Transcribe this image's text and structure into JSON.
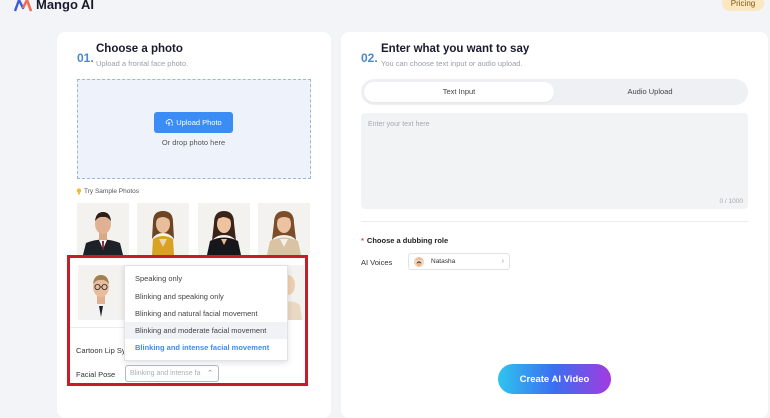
{
  "brand": {
    "name": "Mango AI",
    "pricing": "Pricing"
  },
  "step1": {
    "number": "01.",
    "title": "Choose a photo",
    "subtitle": "Upload a frontal face photo.",
    "upload_button": "Upload Photo",
    "drop_text": "Or drop photo here",
    "try_sample": "Try Sample Photos",
    "cartoon_lip_sync": "Cartoon Lip Sy",
    "facial_pose_label": "Facial Pose",
    "facial_pose_value": "Blinking and intense fa",
    "facial_pose_options": [
      "Speaking only",
      "Blinking and speaking only",
      "Blinking and natural facial movement",
      "Blinking and moderate facial movement",
      "Blinking and intense facial movement"
    ]
  },
  "step2": {
    "number": "02.",
    "title": "Enter what you want to say",
    "subtitle": "You can choose text input or audio upload.",
    "tabs": [
      "Text Input",
      "Audio Upload"
    ],
    "text_placeholder": "Enter your text here",
    "counter": "0 / 1000",
    "dubbing_label": "Choose a dubbing role",
    "dubbing_required": "*",
    "ai_voices_label": "AI Voices",
    "voice_name": "Natasha",
    "create_button": "Create AI Video"
  },
  "colors": {
    "accent": "#3b8cf4",
    "highlight": "#c71c2a",
    "pricing_bg": "#fbe7c0"
  },
  "icons": [
    "mango-logo-icon",
    "upload-icon",
    "bulb-icon",
    "chevron-down-icon",
    "chevron-right-icon"
  ]
}
